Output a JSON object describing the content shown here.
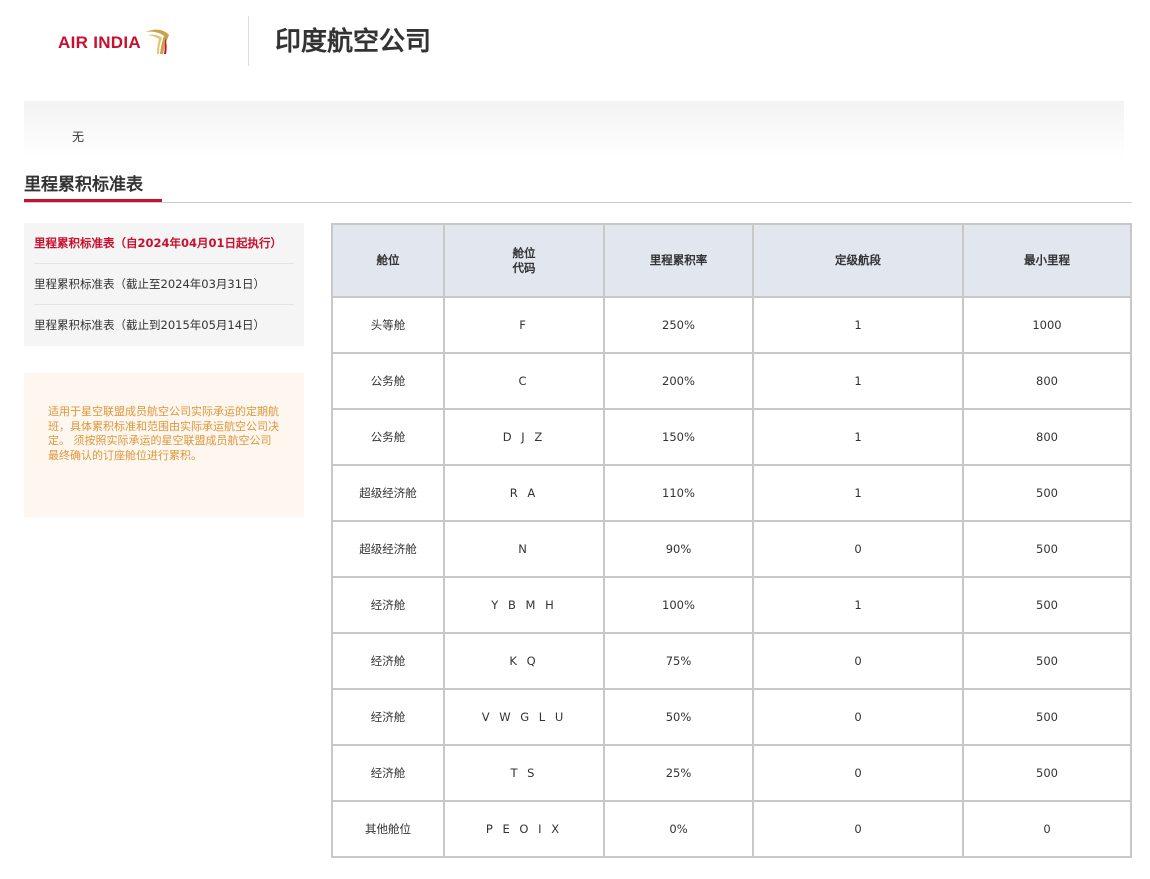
{
  "header": {
    "logo_text": "AIR INDIA",
    "title": "印度航空公司"
  },
  "notice": {
    "text": "无"
  },
  "section": {
    "title": "里程累积标准表"
  },
  "sidebar": {
    "items": [
      {
        "label": "里程累积标准表（自2024年04月01日起执行）",
        "active": true
      },
      {
        "label": "里程累积标准表（截止至2024年03月31日）",
        "active": false
      },
      {
        "label": "里程累积标准表（截止到2015年05月14日）",
        "active": false
      }
    ]
  },
  "rule_note": {
    "text": "适用于星空联盟成员航空公司实际承运的定期航班，具体累积标准和范围由实际承运航空公司决定。 须按照实际承运的星空联盟成员航空公司最终确认的订座舱位进行累积。"
  },
  "table": {
    "headers": {
      "cabin": "舱位",
      "code_line1": "舱位",
      "code_line2": "代码",
      "rate": "里程累积率",
      "segments": "定级航段",
      "min_miles": "最小里程"
    },
    "rows": [
      {
        "cabin": "头等舱",
        "code": "F",
        "rate": "250%",
        "segments": "1",
        "min_miles": "1000"
      },
      {
        "cabin": "公务舱",
        "code": "C",
        "rate": "200%",
        "segments": "1",
        "min_miles": "800"
      },
      {
        "cabin": "公务舱",
        "code": "D J Z",
        "rate": "150%",
        "segments": "1",
        "min_miles": "800"
      },
      {
        "cabin": "超级经济舱",
        "code": "R A",
        "rate": "110%",
        "segments": "1",
        "min_miles": "500"
      },
      {
        "cabin": "超级经济舱",
        "code": "N",
        "rate": "90%",
        "segments": "0",
        "min_miles": "500"
      },
      {
        "cabin": "经济舱",
        "code": "Y B M H",
        "rate": "100%",
        "segments": "1",
        "min_miles": "500"
      },
      {
        "cabin": "经济舱",
        "code": "K Q",
        "rate": "75%",
        "segments": "0",
        "min_miles": "500"
      },
      {
        "cabin": "经济舱",
        "code": "V W G L U",
        "rate": "50%",
        "segments": "0",
        "min_miles": "500"
      },
      {
        "cabin": "经济舱",
        "code": "T S",
        "rate": "25%",
        "segments": "0",
        "min_miles": "500"
      },
      {
        "cabin": "其他舱位",
        "code": "P E O I X",
        "rate": "0%",
        "segments": "0",
        "min_miles": "0"
      }
    ]
  },
  "colors": {
    "brand_red": "#c8102e",
    "logo_gold": "#c9a14a",
    "note_orange": "#e0953a",
    "table_header_bg": "#e1e6ef"
  },
  "icons": {
    "logo_mark": "air-india-window-swirl-icon"
  }
}
